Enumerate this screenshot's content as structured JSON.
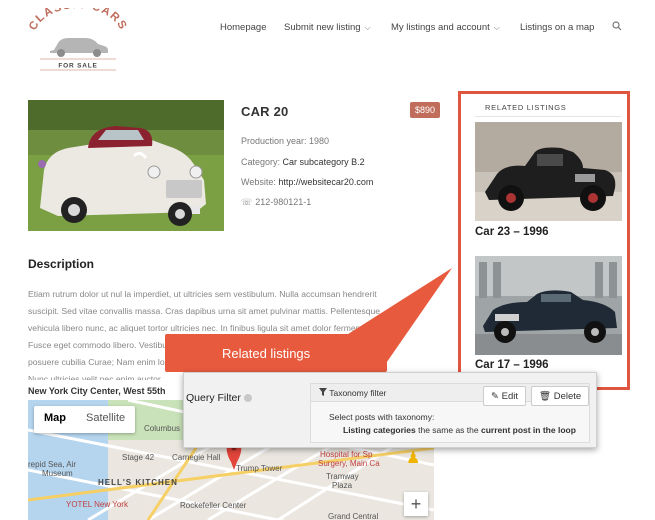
{
  "brand": {
    "line1": "CLASSIC CARS",
    "line2": "FOR SALE",
    "color": "#c06d5b"
  },
  "nav": {
    "items": [
      {
        "label": "Homepage",
        "has_dropdown": false
      },
      {
        "label": "Submit new listing",
        "has_dropdown": true
      },
      {
        "label": "My listings and account",
        "has_dropdown": true
      },
      {
        "label": "Listings on a map",
        "has_dropdown": false
      }
    ],
    "search_icon": "search-icon",
    "dropdown_icon": "⌄"
  },
  "listing": {
    "title": "CAR 20",
    "price": "$890",
    "production_label": "Production year: 1980",
    "category_label": "Category:",
    "category_value": "Car subcategory B.2",
    "website_label": "Website:",
    "website_value": "http://websitecar20.com",
    "phone": "212-980121-1",
    "phone_icon": "☏"
  },
  "description": {
    "heading": "Description",
    "lines": [
      "Etiam rutrum dolor ut nul la imperdiet, ut ultricies sem vestibulum. Nulla accumsan hendrerit",
      "suscipit. Sed vitae convallis massa. Cras dapibus urna sit amet pulvinar mattis. Pellentesque",
      "vehicula libero nunc, ac aliquet tortor ultricies nec. In finibus ligula sit amet dolor fermentum.",
      "Fusce eget commodo libero. Vestibulum ante ipsum primis in faucibus orci luctus et ultrices",
      "posuere cubilia Curae; Nam enim lorem, iaculis ut turpis at, condimentum viverra mauris.",
      "Nunc ultricies velit nec enim auctor"
    ],
    "address": "New York City Center, West 55th"
  },
  "map": {
    "tab_map": "Map",
    "tab_satellite": "Satellite",
    "zoom_in": "+",
    "labels": {
      "columbus": "Columbus",
      "stage42": "Stage 42",
      "carnegie": "Carnegie Hall",
      "trump": "Trump Tower",
      "hospital": "Hospital for Sp",
      "surgery": "Surgery, Main Ca",
      "tramway": "Tramway",
      "plaza": "Plaza",
      "intrepid": "repid Sea, Air",
      "museum": "Museum",
      "kitchen": "HELL'S KITCHEN",
      "rockefeller": "Rockefeller Center",
      "yotel": "YOTEL New York",
      "grand_central": "Grand Central"
    }
  },
  "sidebar": {
    "title": "RELATED LISTINGS",
    "items": [
      {
        "name": "Car 23 – 1996"
      },
      {
        "name": "Car 17 – 1996"
      }
    ],
    "border_color": "#e0553f"
  },
  "callout": {
    "text": "Related listings",
    "color": "#e85a3e"
  },
  "query_filter": {
    "label": "Query Filter",
    "panel_title": "Taxonomy filter",
    "filter_icon": "filter-icon",
    "edit_label": "Edit",
    "delete_label": "Delete",
    "line1": "Select posts with taxonomy:",
    "line2_strong1": "Listing categories",
    "line2_mid": "the same as the",
    "line2_strong2": "current post in the loop"
  }
}
